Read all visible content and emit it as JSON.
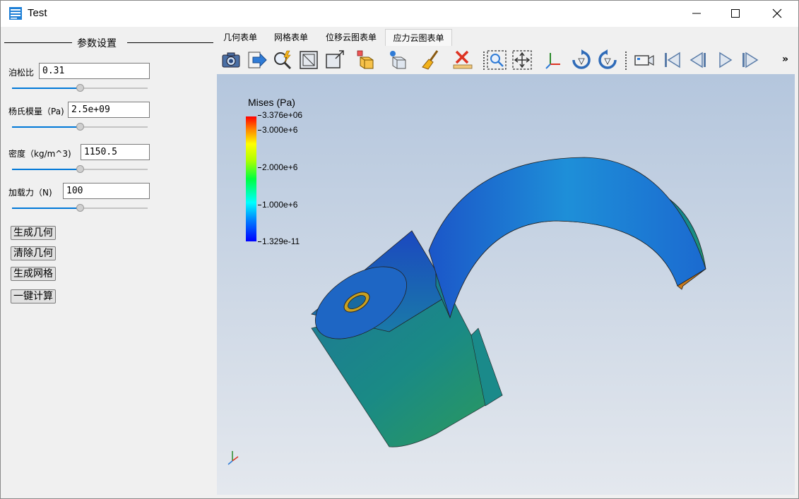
{
  "window": {
    "title": "Test",
    "controls": [
      "minimize-icon",
      "maximize-icon",
      "close-icon"
    ]
  },
  "left_panel": {
    "group_title": "参数设置",
    "params": [
      {
        "label": "泊松比",
        "value": "0.31",
        "slider_level": 0.5
      },
      {
        "label": "杨氏模量（Pa)",
        "value": "2.5e+09",
        "slider_level": 0.5
      },
      {
        "label": "密度（kg/m^3)",
        "value": "1150.5",
        "slider_level": 0.5
      },
      {
        "label": "加载力（N)",
        "value": "100",
        "slider_level": 0.5
      }
    ],
    "buttons": [
      "生成几何",
      "清除几何",
      "生成网格",
      "一键计算"
    ]
  },
  "tabs": [
    {
      "label": "几何表单",
      "active": false
    },
    {
      "label": "网格表单",
      "active": false
    },
    {
      "label": "位移云图表单",
      "active": false
    },
    {
      "label": "应力云图表单",
      "active": true
    }
  ],
  "toolbar": {
    "icons": [
      "camera-icon",
      "save-arrow-icon",
      "select-query-icon",
      "reset-camera-box-icon",
      "zoom-data-box-icon",
      "select-cells-icon",
      "select-points-icon",
      "clear-brush-icon",
      "clear-selection-icon",
      "zoom-to-box-icon",
      "pan-fit-icon",
      "axes-orientation-icon",
      "rotate-cw-icon",
      "rotate-ccw-icon",
      "video-camera-icon",
      "first-frame-icon",
      "previous-frame-icon",
      "play-icon",
      "last-frame-icon"
    ],
    "overflow": "»"
  },
  "viewport": {
    "legend": {
      "title": "Mises (Pa)",
      "ticks": [
        "3.376e+06",
        "3.000e+6",
        "2.000e+6",
        "1.000e+6",
        "1.329e-11"
      ],
      "colors": [
        "#0000ff",
        "#00ffff",
        "#00ff40",
        "#ffff00",
        "#ff0000"
      ]
    },
    "background_top": "#b4c6dd",
    "background_bottom": "#e4e8ee"
  }
}
